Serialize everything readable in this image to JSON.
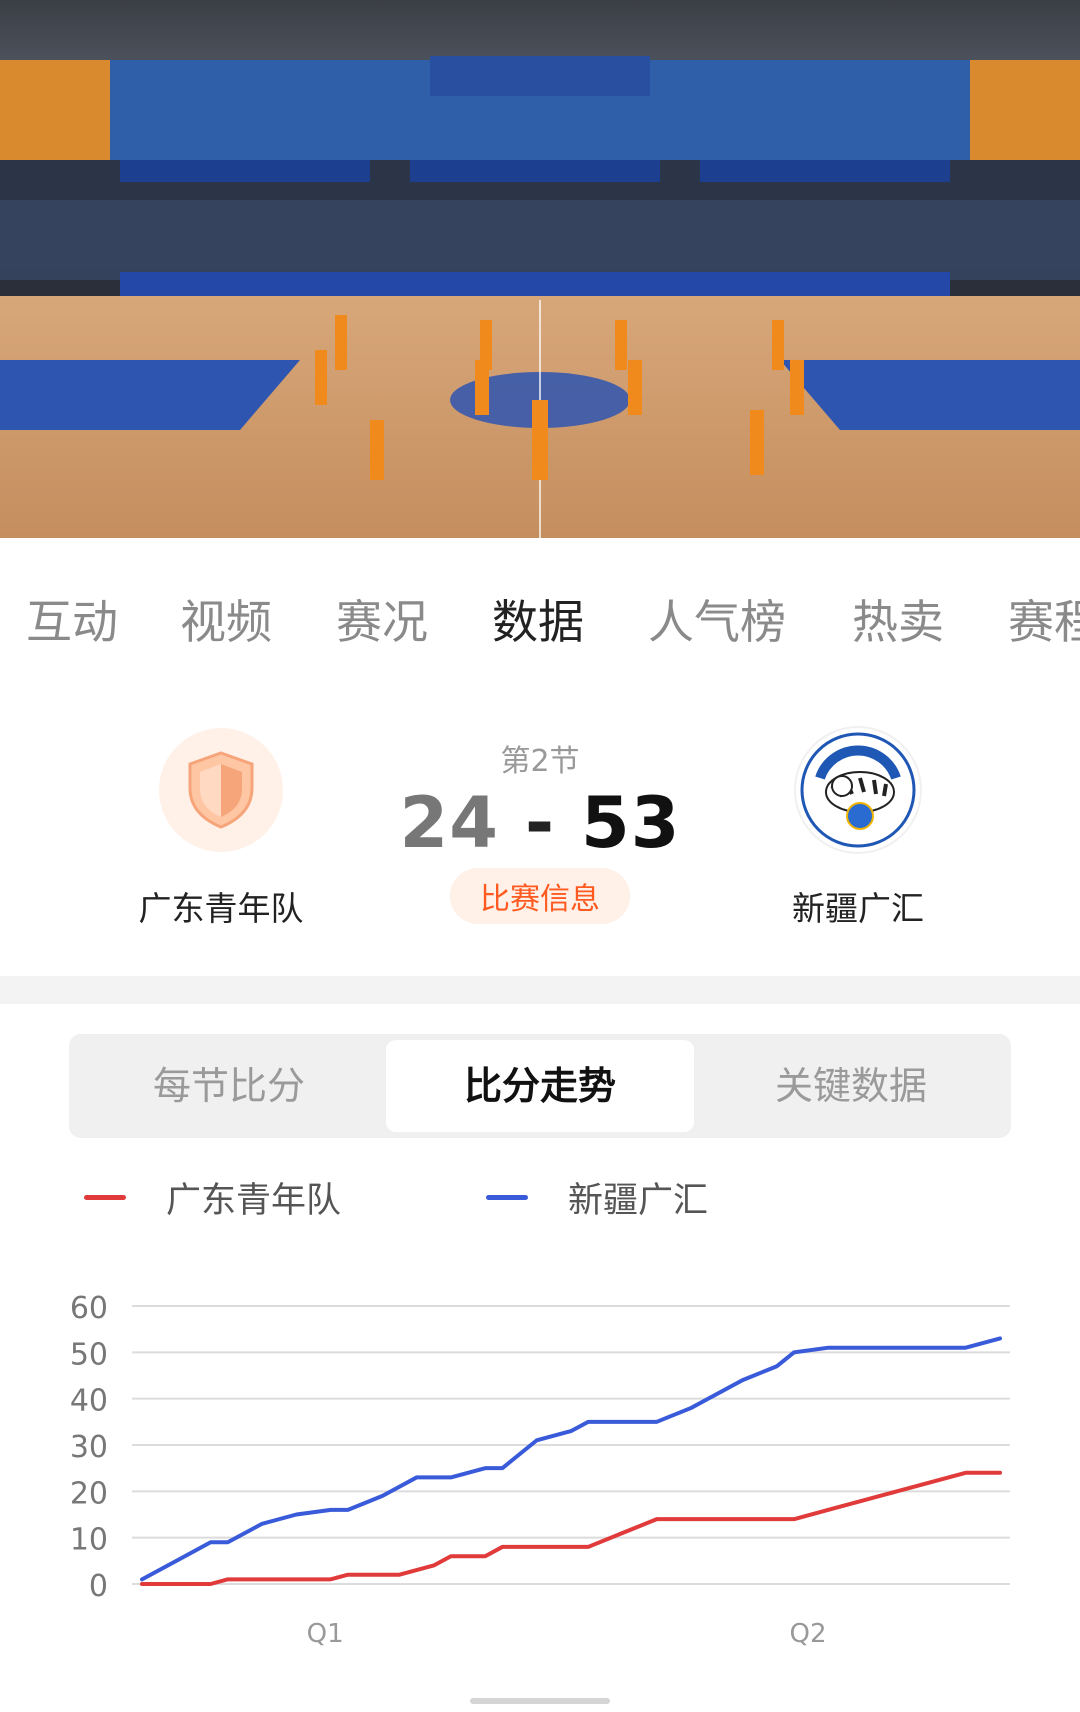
{
  "tabs": [
    "互动",
    "视频",
    "赛况",
    "数据",
    "人气榜",
    "热卖",
    "赛程"
  ],
  "active_tab": "数据",
  "match": {
    "period": "第2节",
    "home_score": "24",
    "dash": "-",
    "away_score": "53",
    "info_button": "比赛信息",
    "home_team": "广东青年队",
    "away_team": "新疆广汇"
  },
  "segments": [
    "每节比分",
    "比分走势",
    "关键数据"
  ],
  "active_segment": "比分走势",
  "colors": {
    "accent": "#ff5a1f",
    "home_series": "#e03a3a",
    "away_series": "#3a5bd9"
  },
  "icons": {
    "home_logo": "shield-icon",
    "away_logo": "tiger-logo"
  },
  "chart_data": {
    "type": "line",
    "legend_position": "top-left",
    "grid": true,
    "ylim": [
      0,
      60
    ],
    "yticks": [
      "0",
      "10",
      "20",
      "30",
      "40",
      "50",
      "60"
    ],
    "xticks": [
      "Q1",
      "Q2"
    ],
    "x": [
      0,
      4,
      8,
      10,
      14,
      18,
      22,
      24,
      28,
      30,
      32,
      34,
      36,
      40,
      42,
      46,
      50,
      52,
      56,
      60,
      64,
      66,
      70,
      74,
      76,
      80,
      84,
      86,
      88,
      92,
      96,
      100
    ],
    "series": [
      {
        "name": "广东青年队",
        "values": [
          0,
          0,
          0,
          1,
          1,
          1,
          1,
          2,
          2,
          2,
          3,
          4,
          6,
          6,
          8,
          8,
          8,
          8,
          11,
          14,
          14,
          14,
          14,
          14,
          14,
          16,
          18,
          19,
          20,
          22,
          24,
          24
        ]
      },
      {
        "name": "新疆广汇",
        "values": [
          1,
          5,
          9,
          9,
          13,
          15,
          16,
          16,
          19,
          21,
          23,
          23,
          23,
          25,
          25,
          31,
          33,
          35,
          35,
          35,
          38,
          40,
          44,
          47,
          50,
          51,
          51,
          51,
          51,
          51,
          51,
          53
        ]
      }
    ]
  }
}
